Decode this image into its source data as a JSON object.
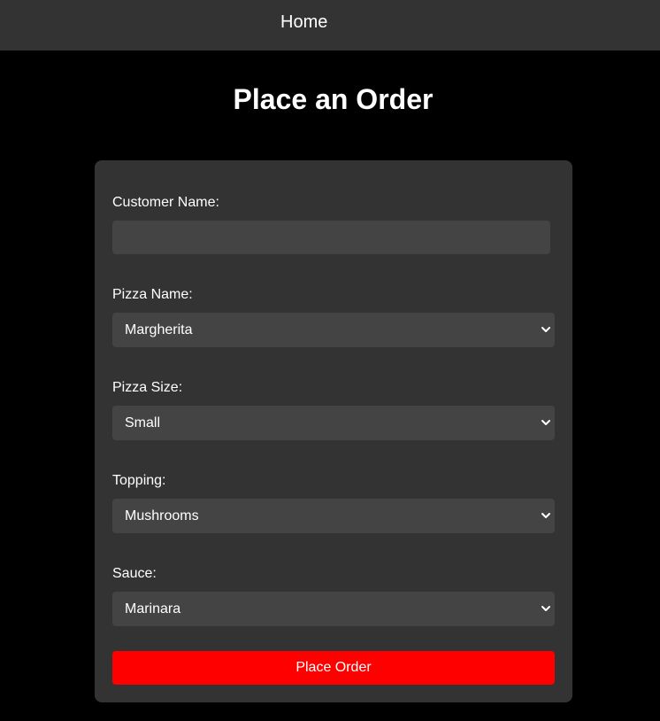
{
  "nav": {
    "home_label": "Home"
  },
  "page": {
    "title": "Place an Order"
  },
  "form": {
    "customer_name": {
      "label": "Customer Name:",
      "value": ""
    },
    "pizza_name": {
      "label": "Pizza Name:",
      "selected": "Margherita"
    },
    "pizza_size": {
      "label": "Pizza Size:",
      "selected": "Small"
    },
    "topping": {
      "label": "Topping:",
      "selected": "Mushrooms"
    },
    "sauce": {
      "label": "Sauce:",
      "selected": "Marinara"
    },
    "submit_label": "Place Order"
  },
  "icons": {
    "dropdown": "chevron-down-icon"
  },
  "colors": {
    "background": "#000000",
    "navbar": "#333333",
    "card": "#333333",
    "field": "#444444",
    "accent": "#ff0000",
    "text": "#ffffff"
  }
}
